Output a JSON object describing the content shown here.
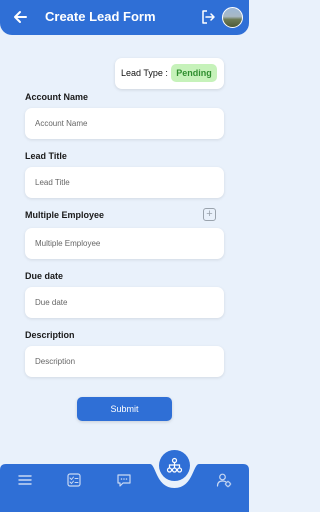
{
  "header": {
    "title": "Create Lead Form"
  },
  "lead_type": {
    "label": "Lead Type :",
    "status": "Pending"
  },
  "fields": [
    {
      "label": "Account Name",
      "placeholder": "Account Name"
    },
    {
      "label": "Lead Title",
      "placeholder": "Lead Title"
    },
    {
      "label": "Multiple Employee",
      "placeholder": "Multiple Employee"
    },
    {
      "label": "Due date",
      "placeholder": "Due date"
    },
    {
      "label": "Description",
      "placeholder": "Description"
    }
  ],
  "submit_label": "Submit",
  "colors": {
    "primary": "#2f6fd6",
    "background": "#e9f1fb",
    "pending_bg": "#c6f2ba",
    "pending_text": "#2f8f2f"
  },
  "icons": [
    "back-arrow-icon",
    "logout-icon",
    "menu-icon",
    "checklist-icon",
    "chat-icon",
    "network-icon",
    "user-settings-icon",
    "add-icon"
  ]
}
